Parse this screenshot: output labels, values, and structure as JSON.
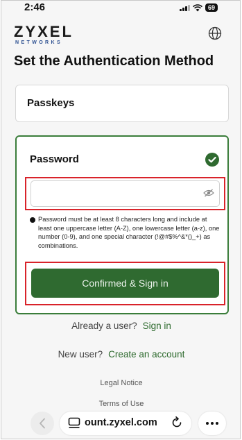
{
  "status_bar": {
    "time": "2:46",
    "battery": "69"
  },
  "brand": {
    "name": "ZYXEL",
    "sub": "NETWORKS",
    "accent_color": "#2f6a30",
    "highlight_color": "#d9232a"
  },
  "page": {
    "title": "Set the Authentication Method"
  },
  "methods": {
    "passkeys_label": "Passkeys",
    "password_label": "Password",
    "password_value": "",
    "password_hint": "Password must be at least 8 characters long and include at least one uppercase letter (A-Z), one lowercase letter (a-z), one number (0-9), and one special character (!@#$%^&*()_+) as combinations.",
    "confirm_button": "Confirmed & Sign in"
  },
  "links": {
    "existing_prompt": "Already a user?",
    "sign_in": "Sign in",
    "new_prompt": "New user?",
    "create_account": "Create an account",
    "legal_notice": "Legal Notice",
    "terms": "Terms of Use"
  },
  "browser": {
    "url": "ount.zyxel.com"
  },
  "icons": [
    "wifi-icon",
    "globe-icon",
    "check-circle-icon",
    "eye-slash-icon",
    "info-icon",
    "back-arrow-icon",
    "tabs-icon",
    "reload-icon",
    "more-icon"
  ]
}
